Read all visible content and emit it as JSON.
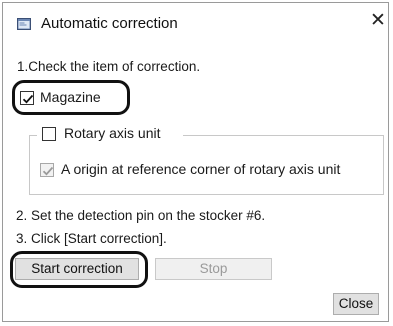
{
  "window": {
    "title": "Automatic correction",
    "close_glyph": "✕"
  },
  "steps": {
    "step1": "1.Check the item of correction.",
    "step2": "2. Set the detection pin on the stocker #6.",
    "step3": "3. Click [Start correction]."
  },
  "options": {
    "magazine": {
      "label": "Magazine",
      "checked": true,
      "enabled": true
    },
    "rotary_axis_unit": {
      "label": "Rotary axis unit",
      "checked": false,
      "enabled": true
    },
    "a_origin": {
      "label": "A origin at reference corner of rotary axis unit",
      "checked": true,
      "enabled": false
    }
  },
  "buttons": {
    "start": "Start correction",
    "stop": "Stop",
    "close": "Close"
  },
  "icons": {
    "title_icon": "app-window-icon"
  },
  "colors": {
    "highlight_outline": "#111111",
    "disabled_check": "#9a9a9a"
  }
}
